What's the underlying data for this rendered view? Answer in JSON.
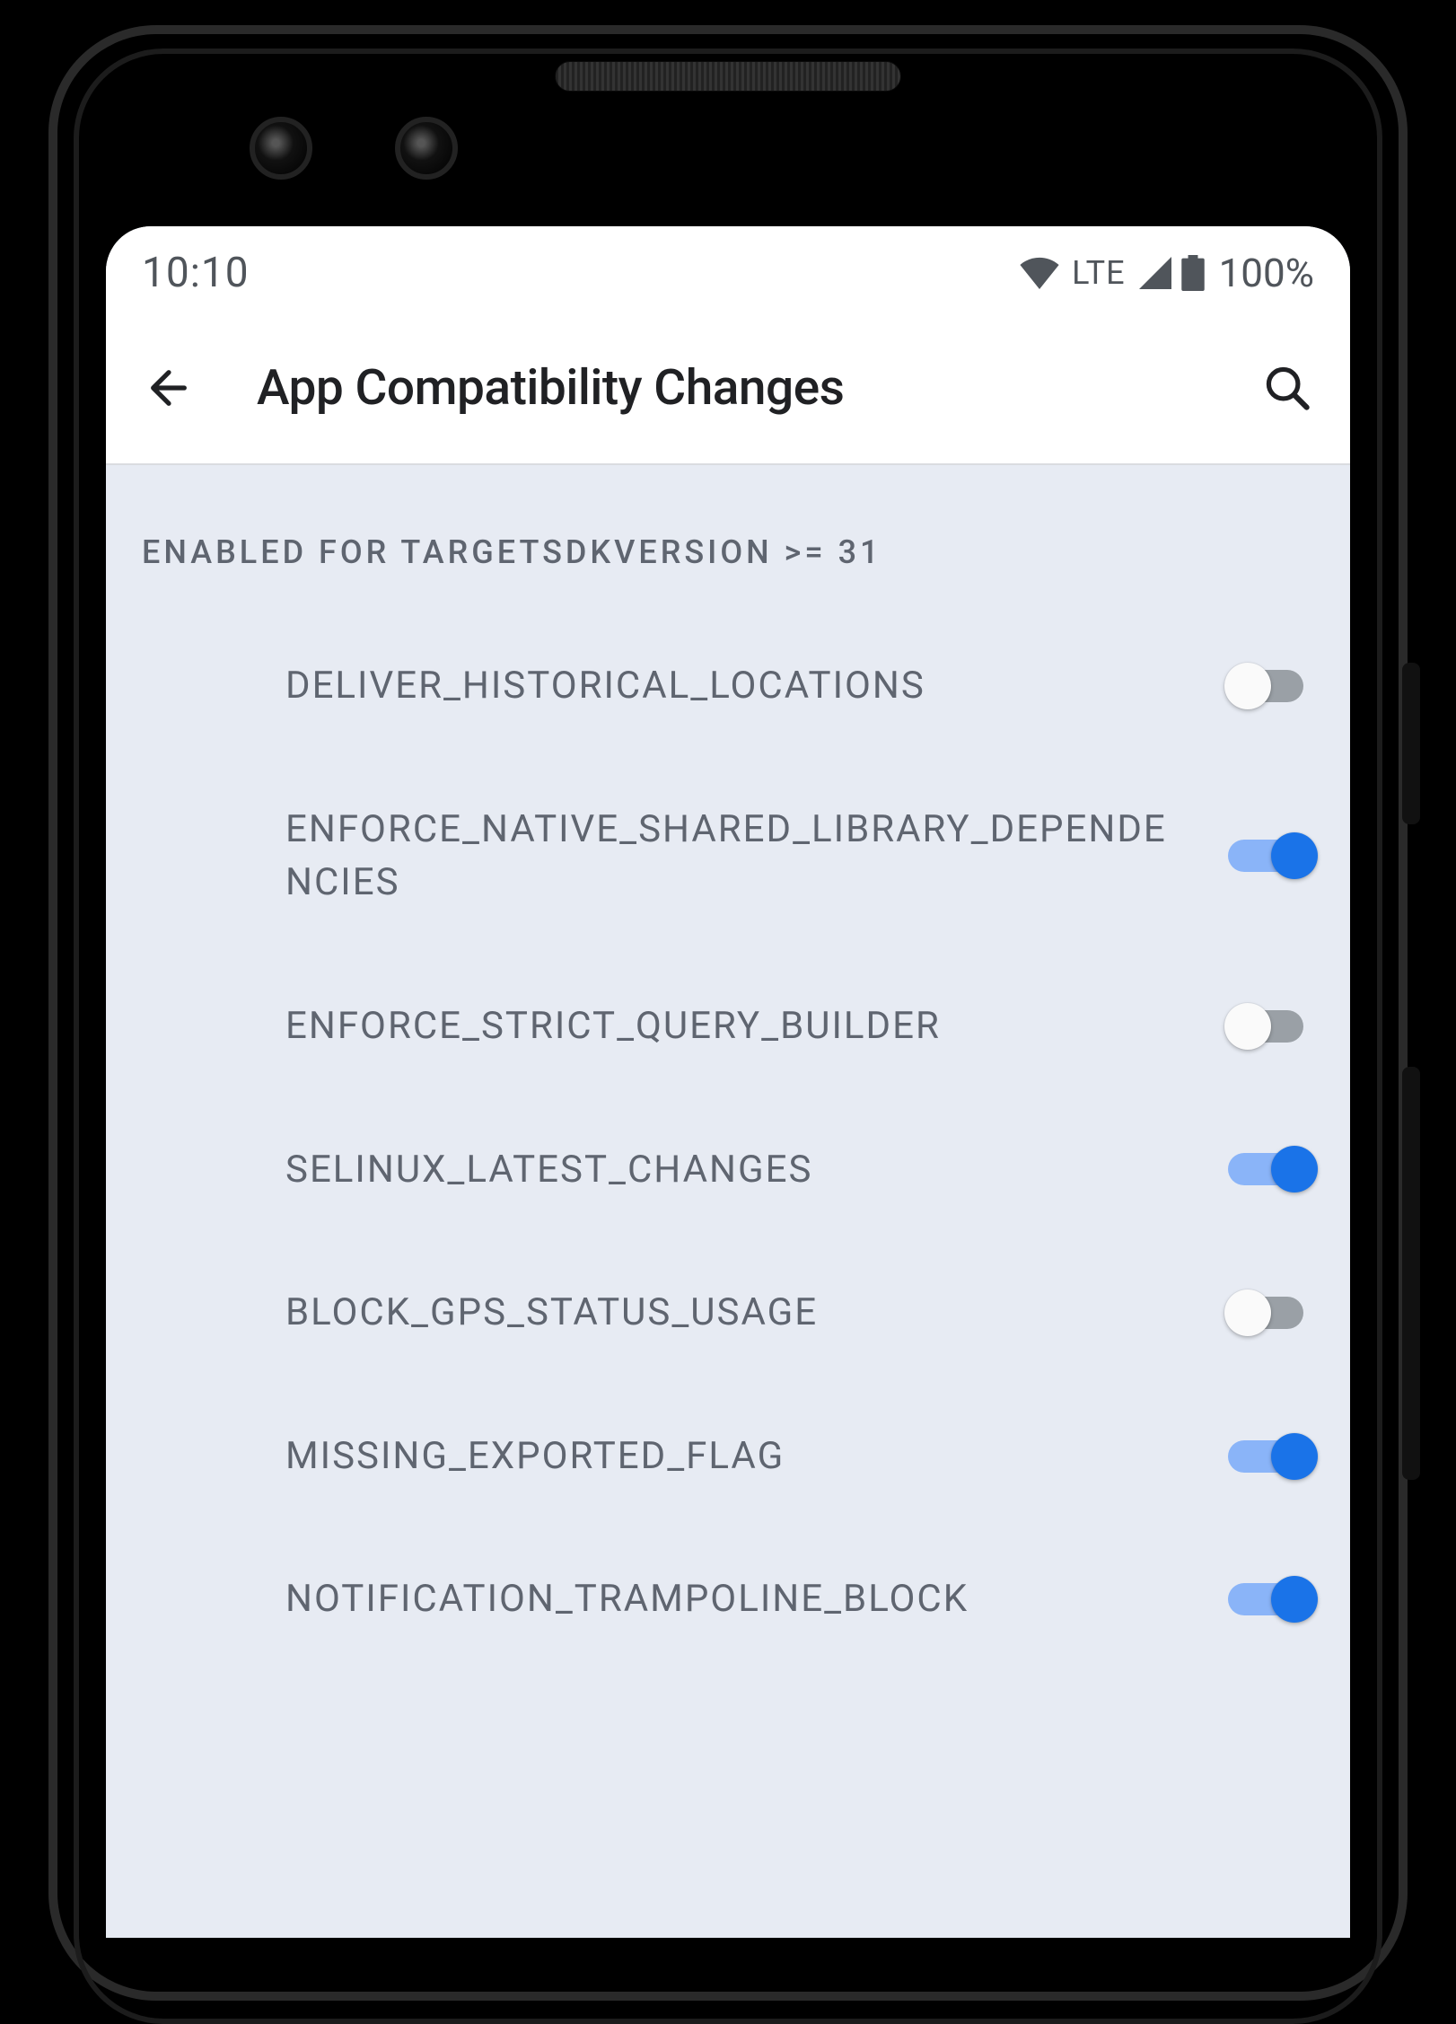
{
  "status": {
    "time": "10:10",
    "network_label": "LTE",
    "battery_pct": "100%"
  },
  "header": {
    "title": "App Compatibility Changes"
  },
  "section": {
    "title": "ENABLED FOR TARGETSDKVERSION >= 31"
  },
  "items": [
    {
      "label": "DELIVER_HISTORICAL_LOCATIONS",
      "on": false
    },
    {
      "label": "ENFORCE_NATIVE_SHARED_LIBRARY_DEPENDENCIES",
      "on": true
    },
    {
      "label": "ENFORCE_STRICT_QUERY_BUILDER",
      "on": false
    },
    {
      "label": "SELINUX_LATEST_CHANGES",
      "on": true
    },
    {
      "label": "BLOCK_GPS_STATUS_USAGE",
      "on": false
    },
    {
      "label": "MISSING_EXPORTED_FLAG",
      "on": true
    },
    {
      "label": "NOTIFICATION_TRAMPOLINE_BLOCK",
      "on": true
    }
  ]
}
